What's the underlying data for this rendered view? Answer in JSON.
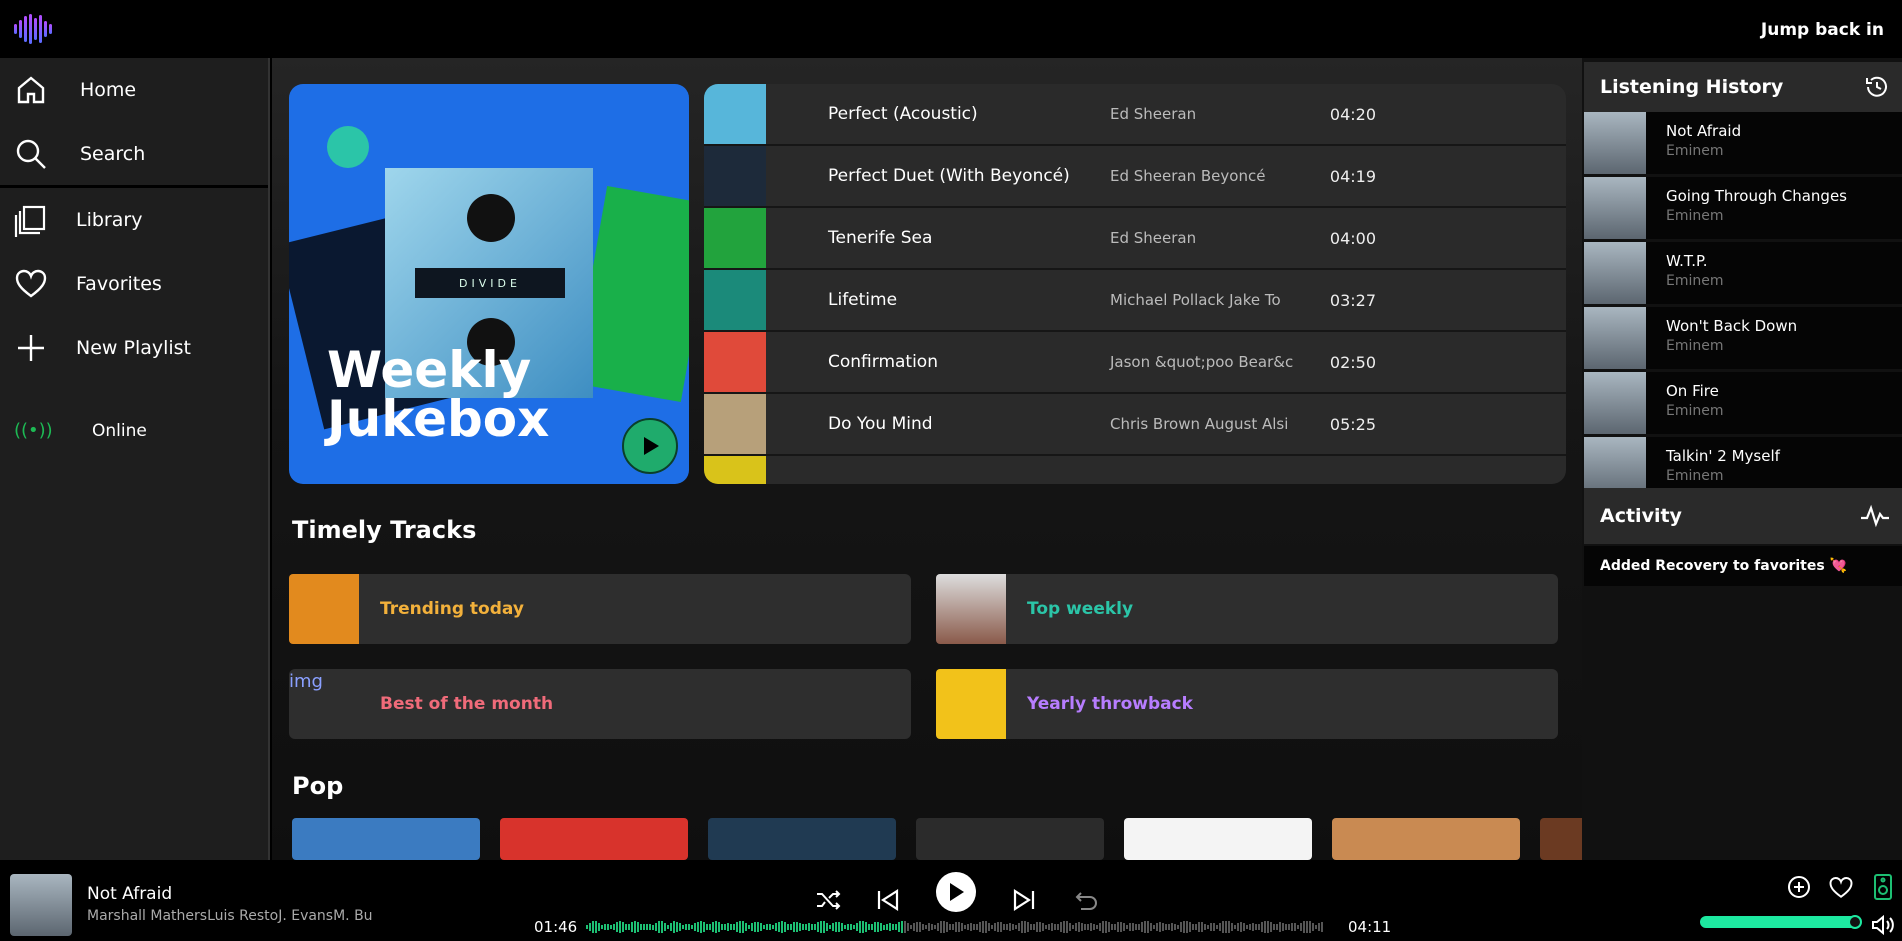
{
  "header": {
    "jump_back_label": "Jump back in"
  },
  "sidebar": {
    "items": [
      {
        "label": "Home",
        "icon": "home-icon"
      },
      {
        "label": "Search",
        "icon": "search-icon"
      },
      {
        "label": "Library",
        "icon": "library-icon"
      },
      {
        "label": "Favorites",
        "icon": "heart-icon"
      },
      {
        "label": "New Playlist",
        "icon": "plus-icon"
      }
    ],
    "status": {
      "label": "Online",
      "icon": "broadcast-icon",
      "color": "#1db954"
    }
  },
  "featured": {
    "title_line1": "Weekly",
    "title_line2": "Jukebox",
    "art_text": "DIVIDE"
  },
  "tracks": [
    {
      "name": "Perfect (Acoustic)",
      "artist": "Ed Sheeran",
      "duration": "04:20",
      "thumb_color": "#57b6da"
    },
    {
      "name": "Perfect Duet (With Beyoncé)",
      "artist": "Ed Sheeran  Beyoncé",
      "duration": "04:19",
      "thumb_color": "#1d2a3a"
    },
    {
      "name": "Tenerife Sea",
      "artist": "Ed Sheeran",
      "duration": "04:00",
      "thumb_color": "#22a33d"
    },
    {
      "name": "Lifetime",
      "artist": "Michael Pollack  Jake To",
      "duration": "03:27",
      "thumb_color": "#1b8a7a"
    },
    {
      "name": "Confirmation",
      "artist": "Jason &quot;poo Bear&c",
      "duration": "02:50",
      "thumb_color": "#e04a3a"
    },
    {
      "name": "Do You Mind",
      "artist": "Chris Brown  August Alsi",
      "duration": "05:25",
      "thumb_color": "#b7a07a"
    },
    {
      "name": "",
      "artist": "",
      "duration": "",
      "thumb_color": "#d9c31a"
    }
  ],
  "timely": {
    "title": "Timely Tracks",
    "tiles": [
      {
        "label": "Trending today",
        "color": "#f3b13b",
        "thumb_color": "#e28a1e"
      },
      {
        "label": "Top weekly",
        "color": "#2bc5a8",
        "thumb_color": "#c9c9c9"
      },
      {
        "label": "Best of the month",
        "color": "#f06b7a",
        "thumb_alt": "img"
      },
      {
        "label": "Yearly throwback",
        "color": "#b77dff",
        "thumb_color": "#f2c21a"
      }
    ]
  },
  "pop": {
    "title": "Pop",
    "cards": [
      "#3b7bc1",
      "#d8332c",
      "#203a52",
      "#2b2b2b",
      "#f4f4f4",
      "#c98a52",
      "#6b3a22"
    ]
  },
  "history": {
    "title": "Listening History",
    "items": [
      {
        "name": "Not Afraid",
        "artist": "Eminem"
      },
      {
        "name": "Going Through Changes",
        "artist": "Eminem"
      },
      {
        "name": "W.T.P.",
        "artist": "Eminem"
      },
      {
        "name": "Won't Back Down",
        "artist": "Eminem"
      },
      {
        "name": "On Fire",
        "artist": "Eminem"
      },
      {
        "name": "Talkin' 2 Myself",
        "artist": "Eminem"
      }
    ]
  },
  "activity": {
    "title": "Activity",
    "items": [
      {
        "text": "Added Recovery to favorites 💘"
      }
    ]
  },
  "player": {
    "title": "Not Afraid",
    "artist": "Marshall MathersLuis RestoJ. EvansM. Bu",
    "elapsed": "01:46",
    "total": "04:11",
    "progress": 0.43,
    "volume": 1.0,
    "accent": "#1dbf73"
  }
}
